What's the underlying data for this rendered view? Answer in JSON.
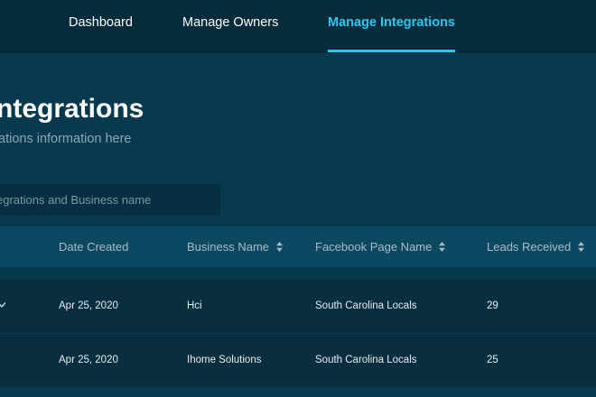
{
  "nav": {
    "items": [
      {
        "label": "Dashboard",
        "active": false
      },
      {
        "label": "Manage Owners",
        "active": false
      },
      {
        "label": "Manage Integrations",
        "active": true
      }
    ]
  },
  "page": {
    "title": "ntegrations",
    "subtitle": "ations information here"
  },
  "search": {
    "placeholder": "egrations and Business name",
    "value": ""
  },
  "table": {
    "headers": [
      {
        "label": "Date Created",
        "sortable": false
      },
      {
        "label": "Business Name",
        "sortable": true
      },
      {
        "label": "Facebook Page Name",
        "sortable": true
      },
      {
        "label": "Leads Received",
        "sortable": true
      }
    ],
    "rows": [
      [
        "Apr 25, 2020",
        "Hci",
        "South Carolina Locals",
        "29"
      ],
      [
        "Apr 25, 2020",
        "Ihome Solutions",
        "South Carolina Locals",
        "25"
      ]
    ]
  },
  "colors": {
    "accent": "#2ec6ef",
    "background": "#073a4f",
    "nav_background": "#042c3d",
    "header_background": "#0d4863",
    "row_background": "#082e40"
  },
  "icons": {
    "sort": "sort-updown-icon",
    "row_expand": "chevron-down-icon"
  }
}
